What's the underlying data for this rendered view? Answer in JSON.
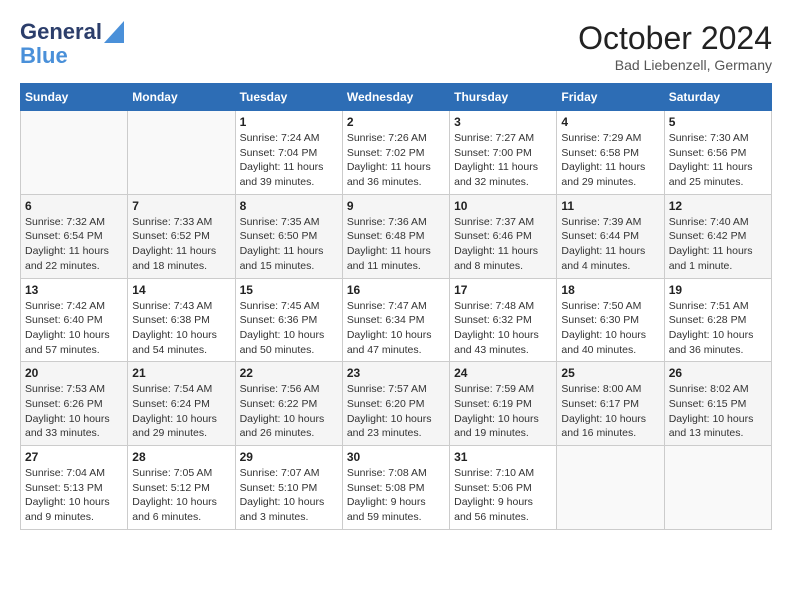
{
  "header": {
    "logo_line1": "General",
    "logo_line2": "Blue",
    "month": "October 2024",
    "location": "Bad Liebenzell, Germany"
  },
  "weekdays": [
    "Sunday",
    "Monday",
    "Tuesday",
    "Wednesday",
    "Thursday",
    "Friday",
    "Saturday"
  ],
  "weeks": [
    [
      {
        "day": "",
        "info": ""
      },
      {
        "day": "",
        "info": ""
      },
      {
        "day": "1",
        "info": "Sunrise: 7:24 AM\nSunset: 7:04 PM\nDaylight: 11 hours and 39 minutes."
      },
      {
        "day": "2",
        "info": "Sunrise: 7:26 AM\nSunset: 7:02 PM\nDaylight: 11 hours and 36 minutes."
      },
      {
        "day": "3",
        "info": "Sunrise: 7:27 AM\nSunset: 7:00 PM\nDaylight: 11 hours and 32 minutes."
      },
      {
        "day": "4",
        "info": "Sunrise: 7:29 AM\nSunset: 6:58 PM\nDaylight: 11 hours and 29 minutes."
      },
      {
        "day": "5",
        "info": "Sunrise: 7:30 AM\nSunset: 6:56 PM\nDaylight: 11 hours and 25 minutes."
      }
    ],
    [
      {
        "day": "6",
        "info": "Sunrise: 7:32 AM\nSunset: 6:54 PM\nDaylight: 11 hours and 22 minutes."
      },
      {
        "day": "7",
        "info": "Sunrise: 7:33 AM\nSunset: 6:52 PM\nDaylight: 11 hours and 18 minutes."
      },
      {
        "day": "8",
        "info": "Sunrise: 7:35 AM\nSunset: 6:50 PM\nDaylight: 11 hours and 15 minutes."
      },
      {
        "day": "9",
        "info": "Sunrise: 7:36 AM\nSunset: 6:48 PM\nDaylight: 11 hours and 11 minutes."
      },
      {
        "day": "10",
        "info": "Sunrise: 7:37 AM\nSunset: 6:46 PM\nDaylight: 11 hours and 8 minutes."
      },
      {
        "day": "11",
        "info": "Sunrise: 7:39 AM\nSunset: 6:44 PM\nDaylight: 11 hours and 4 minutes."
      },
      {
        "day": "12",
        "info": "Sunrise: 7:40 AM\nSunset: 6:42 PM\nDaylight: 11 hours and 1 minute."
      }
    ],
    [
      {
        "day": "13",
        "info": "Sunrise: 7:42 AM\nSunset: 6:40 PM\nDaylight: 10 hours and 57 minutes."
      },
      {
        "day": "14",
        "info": "Sunrise: 7:43 AM\nSunset: 6:38 PM\nDaylight: 10 hours and 54 minutes."
      },
      {
        "day": "15",
        "info": "Sunrise: 7:45 AM\nSunset: 6:36 PM\nDaylight: 10 hours and 50 minutes."
      },
      {
        "day": "16",
        "info": "Sunrise: 7:47 AM\nSunset: 6:34 PM\nDaylight: 10 hours and 47 minutes."
      },
      {
        "day": "17",
        "info": "Sunrise: 7:48 AM\nSunset: 6:32 PM\nDaylight: 10 hours and 43 minutes."
      },
      {
        "day": "18",
        "info": "Sunrise: 7:50 AM\nSunset: 6:30 PM\nDaylight: 10 hours and 40 minutes."
      },
      {
        "day": "19",
        "info": "Sunrise: 7:51 AM\nSunset: 6:28 PM\nDaylight: 10 hours and 36 minutes."
      }
    ],
    [
      {
        "day": "20",
        "info": "Sunrise: 7:53 AM\nSunset: 6:26 PM\nDaylight: 10 hours and 33 minutes."
      },
      {
        "day": "21",
        "info": "Sunrise: 7:54 AM\nSunset: 6:24 PM\nDaylight: 10 hours and 29 minutes."
      },
      {
        "day": "22",
        "info": "Sunrise: 7:56 AM\nSunset: 6:22 PM\nDaylight: 10 hours and 26 minutes."
      },
      {
        "day": "23",
        "info": "Sunrise: 7:57 AM\nSunset: 6:20 PM\nDaylight: 10 hours and 23 minutes."
      },
      {
        "day": "24",
        "info": "Sunrise: 7:59 AM\nSunset: 6:19 PM\nDaylight: 10 hours and 19 minutes."
      },
      {
        "day": "25",
        "info": "Sunrise: 8:00 AM\nSunset: 6:17 PM\nDaylight: 10 hours and 16 minutes."
      },
      {
        "day": "26",
        "info": "Sunrise: 8:02 AM\nSunset: 6:15 PM\nDaylight: 10 hours and 13 minutes."
      }
    ],
    [
      {
        "day": "27",
        "info": "Sunrise: 7:04 AM\nSunset: 5:13 PM\nDaylight: 10 hours and 9 minutes."
      },
      {
        "day": "28",
        "info": "Sunrise: 7:05 AM\nSunset: 5:12 PM\nDaylight: 10 hours and 6 minutes."
      },
      {
        "day": "29",
        "info": "Sunrise: 7:07 AM\nSunset: 5:10 PM\nDaylight: 10 hours and 3 minutes."
      },
      {
        "day": "30",
        "info": "Sunrise: 7:08 AM\nSunset: 5:08 PM\nDaylight: 9 hours and 59 minutes."
      },
      {
        "day": "31",
        "info": "Sunrise: 7:10 AM\nSunset: 5:06 PM\nDaylight: 9 hours and 56 minutes."
      },
      {
        "day": "",
        "info": ""
      },
      {
        "day": "",
        "info": ""
      }
    ]
  ]
}
